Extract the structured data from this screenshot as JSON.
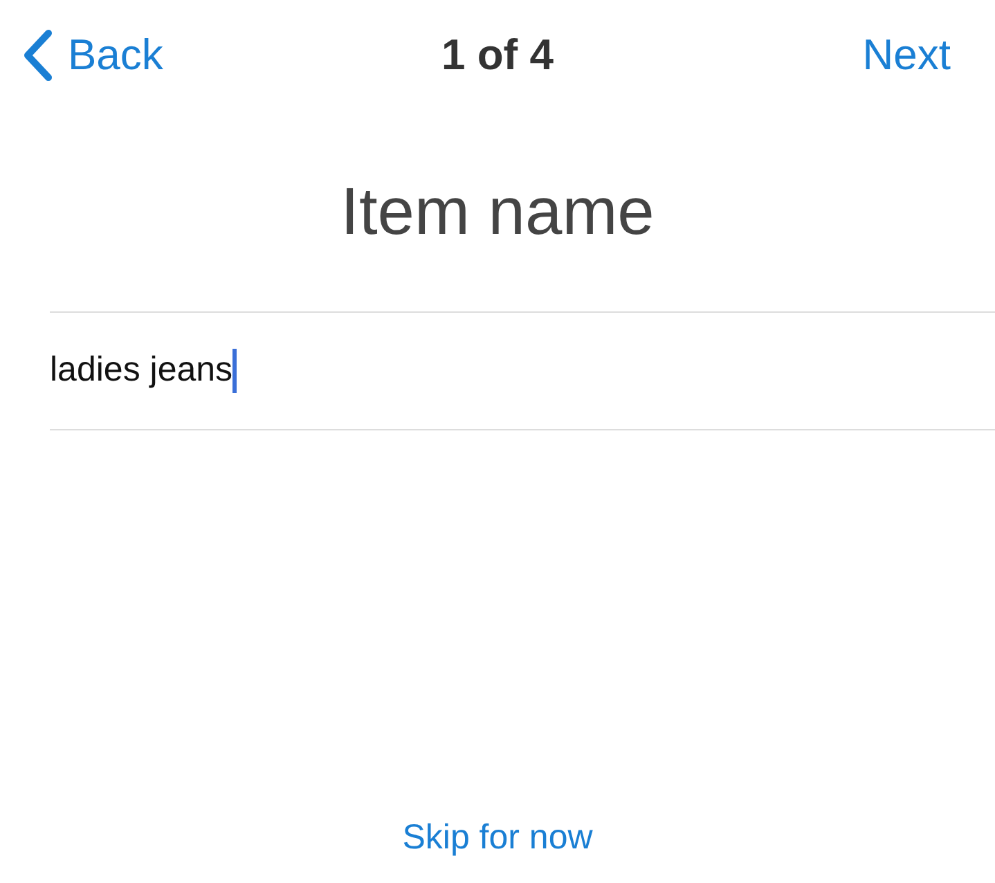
{
  "nav_bar": {
    "back": "Back",
    "title": "1 of 4",
    "next": "Next"
  },
  "heading": "Item name",
  "field": {
    "value": "ladies jeans",
    "focused": true
  },
  "skip_link": "Skip for now"
}
